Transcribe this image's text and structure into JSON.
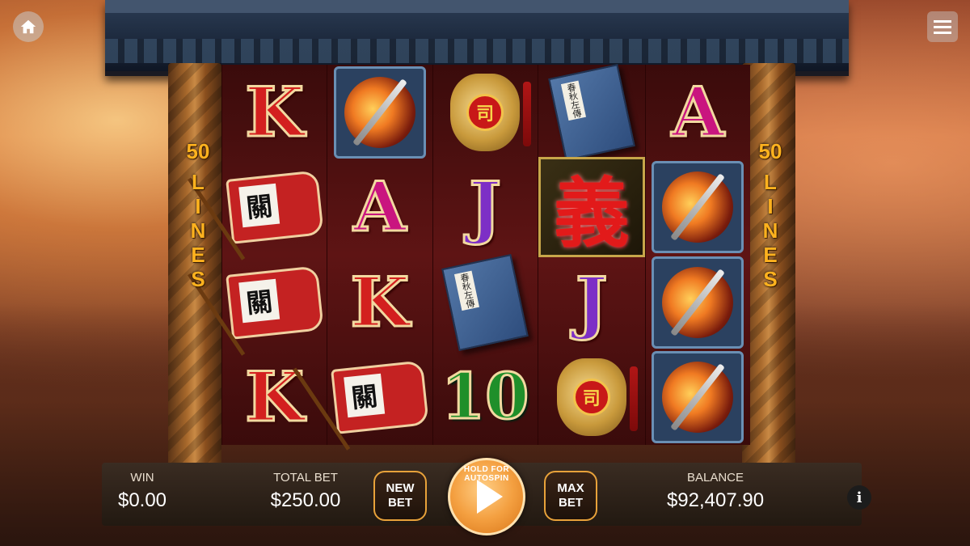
{
  "lines": {
    "count": "50",
    "word": "LINES"
  },
  "reels": [
    [
      {
        "type": "letter",
        "cls": "k",
        "text": "K",
        "name": "symbol-k"
      },
      {
        "type": "flag",
        "text": "關",
        "name": "symbol-banner"
      },
      {
        "type": "flag",
        "text": "關",
        "name": "symbol-banner"
      },
      {
        "type": "letter",
        "cls": "k",
        "text": "K",
        "name": "symbol-k"
      }
    ],
    [
      {
        "type": "blade",
        "name": "symbol-guandao"
      },
      {
        "type": "letter",
        "cls": "a",
        "text": "A",
        "name": "symbol-a"
      },
      {
        "type": "letter",
        "cls": "k",
        "text": "K",
        "name": "symbol-k"
      },
      {
        "type": "flag",
        "text": "關",
        "name": "symbol-banner"
      }
    ],
    [
      {
        "type": "medal",
        "text": "司",
        "name": "symbol-medal"
      },
      {
        "type": "letter",
        "cls": "j",
        "text": "J",
        "name": "symbol-j"
      },
      {
        "type": "book",
        "text": "春秋左傳",
        "name": "symbol-book"
      },
      {
        "type": "letter",
        "cls": "ten",
        "text": "10",
        "name": "symbol-10"
      }
    ],
    [
      {
        "type": "book",
        "text": "春秋左傳",
        "name": "symbol-book"
      },
      {
        "type": "wild",
        "text": "義",
        "name": "symbol-wild"
      },
      {
        "type": "letter",
        "cls": "j",
        "text": "J",
        "name": "symbol-j"
      },
      {
        "type": "medal",
        "text": "司",
        "name": "symbol-medal"
      }
    ],
    [
      {
        "type": "letter",
        "cls": "a",
        "text": "A",
        "name": "symbol-a"
      },
      {
        "type": "blade",
        "name": "symbol-guandao"
      },
      {
        "type": "blade",
        "name": "symbol-guandao"
      },
      {
        "type": "blade",
        "name": "symbol-guandao"
      }
    ]
  ],
  "bar": {
    "win_label": "WIN",
    "win_value": "$0.00",
    "total_bet_label": "TOTAL BET",
    "total_bet_value": "$250.00",
    "balance_label": "BALANCE",
    "balance_value": "$92,407.90",
    "new_bet_line1": "NEW",
    "new_bet_line2": "BET",
    "max_bet_line1": "MAX",
    "max_bet_line2": "BET",
    "spin_hint": "HOLD FOR AUTOSPIN",
    "info": "i"
  },
  "icons": {
    "home": "home-icon",
    "menu": "hamburger-menu-icon",
    "spin": "play-icon"
  }
}
